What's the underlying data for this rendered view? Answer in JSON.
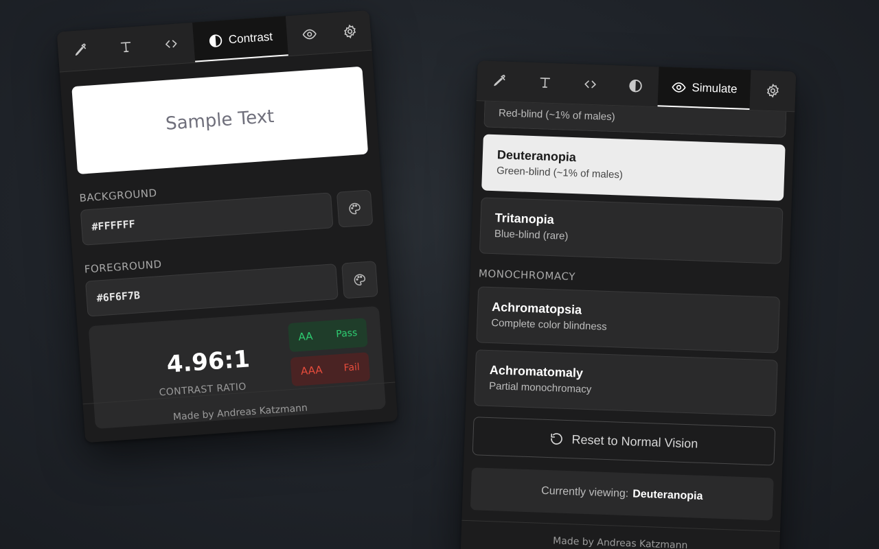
{
  "contrast_panel": {
    "tabs": {
      "active_label": "Contrast"
    },
    "sample_text": "Sample Text",
    "background": {
      "label": "BACKGROUND",
      "value": "#FFFFFF"
    },
    "foreground": {
      "label": "FOREGROUND",
      "value": "#6F6F7B"
    },
    "ratio": {
      "value": "4.96:1",
      "label": "CONTRAST RATIO"
    },
    "badges": [
      {
        "level": "AA",
        "result": "Pass"
      },
      {
        "level": "AAA",
        "result": "Fail"
      }
    ],
    "footer": "Made by Andreas Katzmann"
  },
  "simulate_panel": {
    "tabs": {
      "active_label": "Simulate"
    },
    "partial_option_desc": "Red-blind (~1% of males)",
    "options": [
      {
        "name": "Deuteranopia",
        "desc": "Green-blind (~1% of males)"
      },
      {
        "name": "Tritanopia",
        "desc": "Blue-blind (rare)"
      }
    ],
    "section_monochromacy": "MONOCHROMACY",
    "mono_options": [
      {
        "name": "Achromatopsia",
        "desc": "Complete color blindness"
      },
      {
        "name": "Achromatomaly",
        "desc": "Partial monochromacy"
      }
    ],
    "reset_label": "Reset to Normal Vision",
    "viewing": {
      "prefix": "Currently viewing:",
      "value": "Deuteranopia"
    },
    "footer": "Made by Andreas Katzmann"
  },
  "colors": {
    "pass": "#2ecc71",
    "fail": "#e74c3c",
    "sample_fg": "#6F6F7B",
    "sample_bg": "#FFFFFF"
  },
  "icons": {
    "tabs": [
      "eyedropper-icon",
      "text-icon",
      "code-icon",
      "contrast-icon",
      "eye-icon",
      "gear-icon"
    ],
    "field_button": "palette-icon",
    "reset": "rotate-ccw-icon"
  }
}
